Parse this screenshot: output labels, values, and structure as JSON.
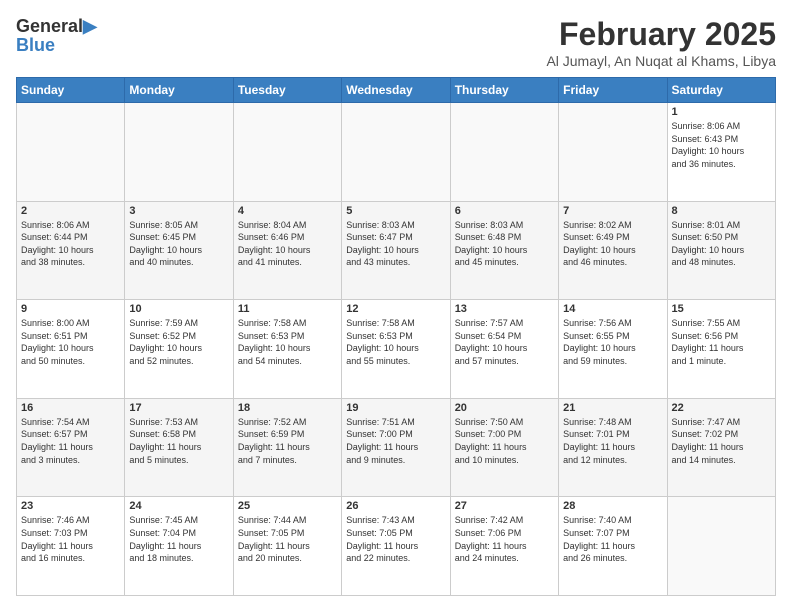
{
  "logo": {
    "line1": "General",
    "line2": "Blue"
  },
  "title": "February 2025",
  "location": "Al Jumayl, An Nuqat al Khams, Libya",
  "weekdays": [
    "Sunday",
    "Monday",
    "Tuesday",
    "Wednesday",
    "Thursday",
    "Friday",
    "Saturday"
  ],
  "weeks": [
    [
      {
        "day": "",
        "info": ""
      },
      {
        "day": "",
        "info": ""
      },
      {
        "day": "",
        "info": ""
      },
      {
        "day": "",
        "info": ""
      },
      {
        "day": "",
        "info": ""
      },
      {
        "day": "",
        "info": ""
      },
      {
        "day": "1",
        "info": "Sunrise: 8:06 AM\nSunset: 6:43 PM\nDaylight: 10 hours\nand 36 minutes."
      }
    ],
    [
      {
        "day": "2",
        "info": "Sunrise: 8:06 AM\nSunset: 6:44 PM\nDaylight: 10 hours\nand 38 minutes."
      },
      {
        "day": "3",
        "info": "Sunrise: 8:05 AM\nSunset: 6:45 PM\nDaylight: 10 hours\nand 40 minutes."
      },
      {
        "day": "4",
        "info": "Sunrise: 8:04 AM\nSunset: 6:46 PM\nDaylight: 10 hours\nand 41 minutes."
      },
      {
        "day": "5",
        "info": "Sunrise: 8:03 AM\nSunset: 6:47 PM\nDaylight: 10 hours\nand 43 minutes."
      },
      {
        "day": "6",
        "info": "Sunrise: 8:03 AM\nSunset: 6:48 PM\nDaylight: 10 hours\nand 45 minutes."
      },
      {
        "day": "7",
        "info": "Sunrise: 8:02 AM\nSunset: 6:49 PM\nDaylight: 10 hours\nand 46 minutes."
      },
      {
        "day": "8",
        "info": "Sunrise: 8:01 AM\nSunset: 6:50 PM\nDaylight: 10 hours\nand 48 minutes."
      }
    ],
    [
      {
        "day": "9",
        "info": "Sunrise: 8:00 AM\nSunset: 6:51 PM\nDaylight: 10 hours\nand 50 minutes."
      },
      {
        "day": "10",
        "info": "Sunrise: 7:59 AM\nSunset: 6:52 PM\nDaylight: 10 hours\nand 52 minutes."
      },
      {
        "day": "11",
        "info": "Sunrise: 7:58 AM\nSunset: 6:53 PM\nDaylight: 10 hours\nand 54 minutes."
      },
      {
        "day": "12",
        "info": "Sunrise: 7:58 AM\nSunset: 6:53 PM\nDaylight: 10 hours\nand 55 minutes."
      },
      {
        "day": "13",
        "info": "Sunrise: 7:57 AM\nSunset: 6:54 PM\nDaylight: 10 hours\nand 57 minutes."
      },
      {
        "day": "14",
        "info": "Sunrise: 7:56 AM\nSunset: 6:55 PM\nDaylight: 10 hours\nand 59 minutes."
      },
      {
        "day": "15",
        "info": "Sunrise: 7:55 AM\nSunset: 6:56 PM\nDaylight: 11 hours\nand 1 minute."
      }
    ],
    [
      {
        "day": "16",
        "info": "Sunrise: 7:54 AM\nSunset: 6:57 PM\nDaylight: 11 hours\nand 3 minutes."
      },
      {
        "day": "17",
        "info": "Sunrise: 7:53 AM\nSunset: 6:58 PM\nDaylight: 11 hours\nand 5 minutes."
      },
      {
        "day": "18",
        "info": "Sunrise: 7:52 AM\nSunset: 6:59 PM\nDaylight: 11 hours\nand 7 minutes."
      },
      {
        "day": "19",
        "info": "Sunrise: 7:51 AM\nSunset: 7:00 PM\nDaylight: 11 hours\nand 9 minutes."
      },
      {
        "day": "20",
        "info": "Sunrise: 7:50 AM\nSunset: 7:00 PM\nDaylight: 11 hours\nand 10 minutes."
      },
      {
        "day": "21",
        "info": "Sunrise: 7:48 AM\nSunset: 7:01 PM\nDaylight: 11 hours\nand 12 minutes."
      },
      {
        "day": "22",
        "info": "Sunrise: 7:47 AM\nSunset: 7:02 PM\nDaylight: 11 hours\nand 14 minutes."
      }
    ],
    [
      {
        "day": "23",
        "info": "Sunrise: 7:46 AM\nSunset: 7:03 PM\nDaylight: 11 hours\nand 16 minutes."
      },
      {
        "day": "24",
        "info": "Sunrise: 7:45 AM\nSunset: 7:04 PM\nDaylight: 11 hours\nand 18 minutes."
      },
      {
        "day": "25",
        "info": "Sunrise: 7:44 AM\nSunset: 7:05 PM\nDaylight: 11 hours\nand 20 minutes."
      },
      {
        "day": "26",
        "info": "Sunrise: 7:43 AM\nSunset: 7:05 PM\nDaylight: 11 hours\nand 22 minutes."
      },
      {
        "day": "27",
        "info": "Sunrise: 7:42 AM\nSunset: 7:06 PM\nDaylight: 11 hours\nand 24 minutes."
      },
      {
        "day": "28",
        "info": "Sunrise: 7:40 AM\nSunset: 7:07 PM\nDaylight: 11 hours\nand 26 minutes."
      },
      {
        "day": "",
        "info": ""
      }
    ]
  ]
}
